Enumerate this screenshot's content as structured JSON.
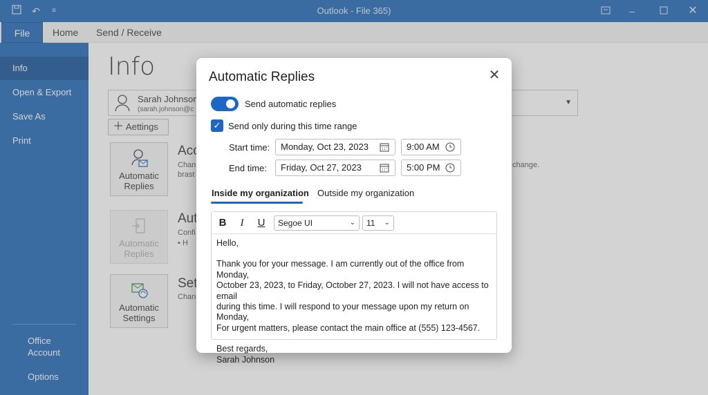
{
  "window": {
    "title": "Outlook - File 365)"
  },
  "ribbon": {
    "tabs": [
      "File",
      "Home",
      "Send / Receive"
    ]
  },
  "sidebar": {
    "items": [
      "Info",
      "Open & Export",
      "Save As",
      "Print"
    ],
    "bottom": [
      "Office Account",
      "Options"
    ]
  },
  "main": {
    "title": "Info",
    "account": {
      "name": "Sarah Johnson",
      "email": "(sarah.johnson@c"
    },
    "add_button": "Aettings",
    "tiles": [
      {
        "label": "Automatic Replies",
        "icon": "person-mail-icon"
      },
      {
        "label": "Automatic Replies",
        "icon": "door-arrow-icon"
      },
      {
        "label": "Automatic Settings",
        "icon": "sync-arrows-icon"
      }
    ],
    "sections": [
      {
        "heading": "Acc",
        "text": [
          "Chan",
          "brast"
        ],
        "trailing": "change."
      },
      {
        "heading": "Aut",
        "text": [
          "Confi",
          "▪  H"
        ]
      },
      {
        "heading": "Set",
        "text": [
          "Chan"
        ]
      }
    ]
  },
  "dialog": {
    "title": "Automatic Replies",
    "toggle_label": "Send automatic replies",
    "toggle_on": true,
    "checkbox_label": "Send only during this time range",
    "checkbox_checked": true,
    "start_label": "Start time:",
    "start_date": "Monday, Oct 23, 2023",
    "start_time": "9:00 AM",
    "end_label": "End time:",
    "end_date": "Friday, Oct 27, 2023",
    "end_time": "5:00 PM",
    "tabs": [
      "Inside my organization",
      "Outside my organization"
    ],
    "active_tab": "Inside my organization",
    "toolbar": {
      "bold": "B",
      "italic": "I",
      "underline": "U",
      "font": "Segoe UI",
      "size": "11"
    },
    "message": {
      "greeting": "Hello,",
      "lines": [
        "Thank you for your message. I am currently out of the office from Monday,",
        "October 23, 2023, to Friday, October 27, 2023. I will not have access to email",
        "during this time. I will respond to your message upon my return on Monday,",
        "For urgent matters, please contact the main office at (555) 123-4567."
      ],
      "closing": "Best regards,",
      "signature": "Sarah Johnson"
    }
  },
  "colors": {
    "accent": "#1b66b6",
    "sidebar_active": "#0f4f97",
    "toggle": "#1d67c4"
  }
}
